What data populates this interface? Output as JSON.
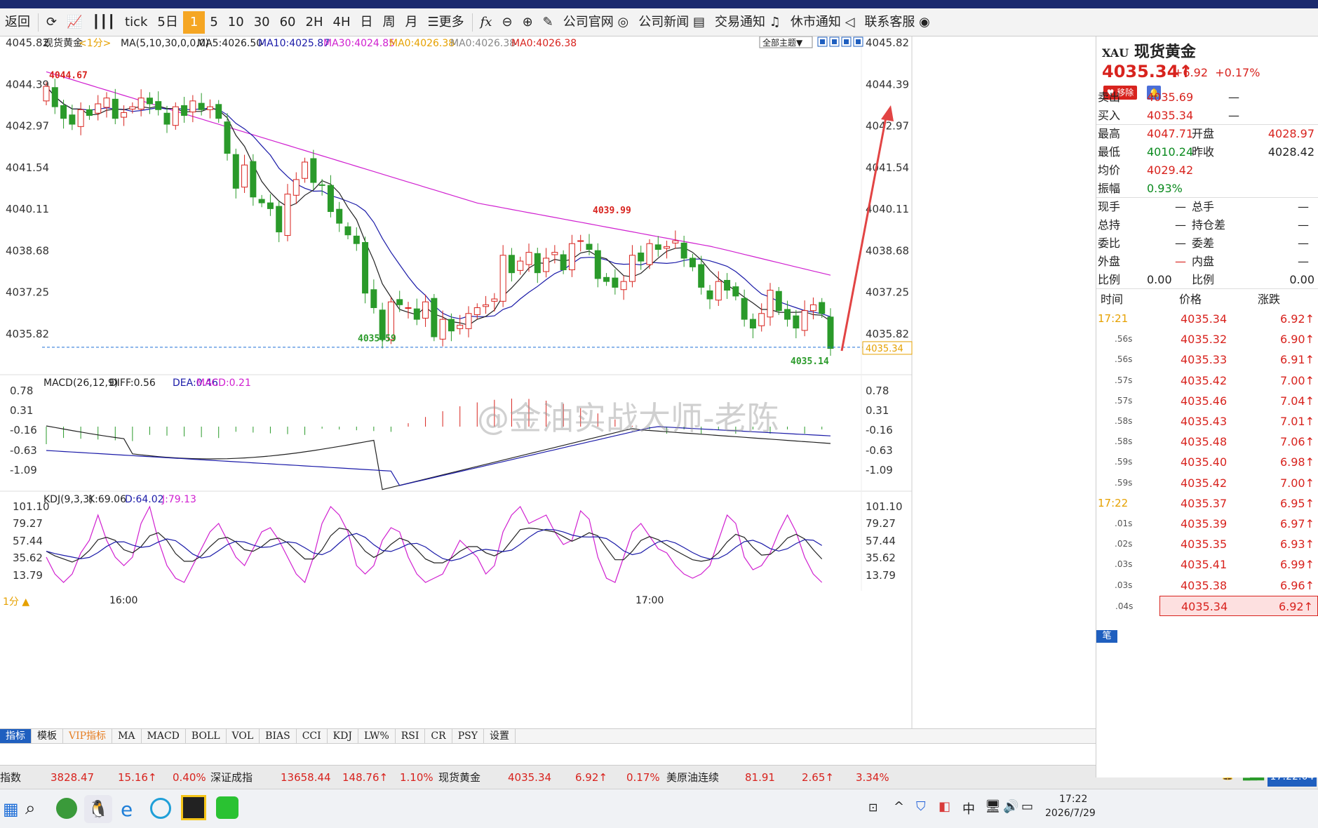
{
  "toolbar": {
    "back": "返回",
    "tick": "tick",
    "five_day": "5日",
    "p1": "1",
    "p5": "5",
    "p10": "10",
    "p30": "30",
    "p60": "60",
    "p2h": "2H",
    "p4h": "4H",
    "day": "日",
    "week": "周",
    "month": "月",
    "more": "更多",
    "links": [
      "公司官网",
      "公司新闻",
      "交易通知",
      "休市通知",
      "联系客服"
    ]
  },
  "main_chart": {
    "instrument": "现货黄金",
    "period": "<1分>",
    "ma_label": "MA(5,10,30,0,0,0)",
    "ma5": "MA5:4026.50",
    "ma10": "MA10:4025.87",
    "ma30": "MA30:4024.85",
    "ma0a": "MA0:4026.38",
    "ma0b": "MA0:4026.38",
    "ma0c": "MA0:4026.38",
    "theme_btn": "全部主题▼",
    "y_ticks": [
      "4045.82",
      "4044.39",
      "4042.97",
      "4041.54",
      "4040.11",
      "4038.68",
      "4037.25",
      "4035.82"
    ],
    "high_label": "4044.67",
    "low_label": "4035.59",
    "mid_high": "4039.99",
    "last_low": "4035.14",
    "price_tag": "4035.34"
  },
  "macd": {
    "title": "MACD(26,12,9)",
    "diff": "DIFF:0.56",
    "dea": "DEA:0.46",
    "macd": "MACD:0.21",
    "y_ticks": [
      "0.78",
      "0.31",
      "-0.16",
      "-0.63",
      "-1.09"
    ]
  },
  "kdj": {
    "title": "KDJ(9,3,3)",
    "k": "K:69.06",
    "d": "D:64.02",
    "j": "J:79.13",
    "y_ticks": [
      "101.10",
      "79.27",
      "57.44",
      "35.62",
      "13.79"
    ]
  },
  "time_axis": {
    "period": "1分",
    "t1": "16:00",
    "t2": "17:00"
  },
  "watermark": "@金油实战大师-老陈",
  "bottom_tabs": [
    "指标",
    "模板",
    "VIP指标",
    "MA",
    "MACD",
    "BOLL",
    "VOL",
    "BIAS",
    "CCI",
    "KDJ",
    "LW%",
    "RSI",
    "CR",
    "PSY",
    "设置"
  ],
  "ticker": [
    "指数",
    "3828.47",
    "15.16↑",
    "0.40%",
    "深证成指",
    "13658.44",
    "148.76↑",
    "1.10%",
    "现货黄金",
    "4035.34",
    "6.92↑",
    "0.17%",
    "美原油连续",
    "81.91",
    "2.65↑",
    "3.34%"
  ],
  "quote": {
    "code": "XAU",
    "name": "现货黄金",
    "price": "4035.34",
    "change": "+6.92",
    "pct": "+0.17%",
    "remove": "移除",
    "rows": [
      {
        "l1": "卖出",
        "v1": "4035.69",
        "l2": "",
        "v2": "—"
      },
      {
        "l1": "买入",
        "v1": "4035.34",
        "l2": "",
        "v2": "—"
      },
      {
        "l1": "最高",
        "v1": "4047.71",
        "l2": "开盘",
        "v2": "4028.97"
      },
      {
        "l1": "最低",
        "v1": "4010.24",
        "l2": "昨收",
        "v2": "4028.42"
      },
      {
        "l1": "均价",
        "v1": "4029.42",
        "l2": "",
        "v2": ""
      },
      {
        "l1": "振幅",
        "v1": "0.93%",
        "l2": "",
        "v2": ""
      },
      {
        "l1": "现手",
        "v1": "—",
        "l2": "总手",
        "v2": "—"
      },
      {
        "l1": "总持",
        "v1": "—",
        "l2": "持仓差",
        "v2": "—"
      },
      {
        "l1": "委比",
        "v1": "—",
        "l2": "委差",
        "v2": "—"
      },
      {
        "l1": "外盘",
        "v1": "—",
        "l2": "内盘",
        "v2": "—"
      },
      {
        "l1": "比例",
        "v1": "0.00",
        "l2": "比例",
        "v2": "0.00"
      }
    ],
    "trade_header": [
      "时间",
      "价格",
      "涨跌"
    ],
    "trades": [
      {
        "t": "17:21",
        "p": "4035.34",
        "c": "6.92"
      },
      {
        "t": "56s",
        "p": "4035.32",
        "c": "6.90"
      },
      {
        "t": "56s",
        "p": "4035.33",
        "c": "6.91"
      },
      {
        "t": "57s",
        "p": "4035.42",
        "c": "7.00"
      },
      {
        "t": "57s",
        "p": "4035.46",
        "c": "7.04"
      },
      {
        "t": "58s",
        "p": "4035.43",
        "c": "7.01"
      },
      {
        "t": "58s",
        "p": "4035.48",
        "c": "7.06"
      },
      {
        "t": "59s",
        "p": "4035.40",
        "c": "6.98"
      },
      {
        "t": "59s",
        "p": "4035.42",
        "c": "7.00"
      },
      {
        "t": "17:22",
        "p": "4035.37",
        "c": "6.95"
      },
      {
        "t": "01s",
        "p": "4035.39",
        "c": "6.97"
      },
      {
        "t": "02s",
        "p": "4035.35",
        "c": "6.93"
      },
      {
        "t": "03s",
        "p": "4035.41",
        "c": "6.99"
      },
      {
        "t": "03s",
        "p": "4035.38",
        "c": "6.96"
      },
      {
        "t": "04s",
        "p": "4035.34",
        "c": "6.92"
      }
    ],
    "bottom_tab": "笔",
    "clock": "17:22:04"
  },
  "taskbar": {
    "time": "17:22",
    "date": "2026/7/29",
    "ime": "中"
  }
}
